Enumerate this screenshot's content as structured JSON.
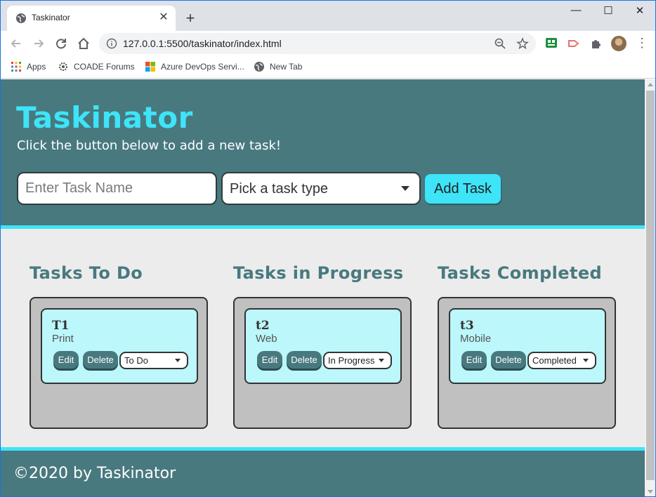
{
  "browser": {
    "tab_title": "Taskinator",
    "new_tab_symbol": "+",
    "close_symbol": "✕",
    "url": "127.0.0.1:5500/taskinator/index.html",
    "bookmarks": [
      "Apps",
      "COADE Forums",
      "Azure DevOps Servi...",
      "New Tab"
    ],
    "window_controls": {
      "minimize": "—",
      "maximize": "☐",
      "close": "✕"
    },
    "menu_symbol": "⋮"
  },
  "header": {
    "title": "Taskinator",
    "subtitle": "Click the button below to add a new task!",
    "task_name_placeholder": "Enter Task Name",
    "task_type_placeholder": "Pick a task type",
    "add_button_label": "Add Task"
  },
  "columns": [
    {
      "title": "Tasks To Do",
      "tasks": [
        {
          "name": "T1",
          "type": "Print",
          "status": "To Do"
        }
      ]
    },
    {
      "title": "Tasks in Progress",
      "tasks": [
        {
          "name": "t2",
          "type": "Web",
          "status": "In Progress"
        }
      ]
    },
    {
      "title": "Tasks Completed",
      "tasks": [
        {
          "name": "t3",
          "type": "Mobile",
          "status": "Completed"
        }
      ]
    }
  ],
  "task_actions": {
    "edit_label": "Edit",
    "delete_label": "Delete"
  },
  "footer": {
    "text": "©2020 by Taskinator"
  },
  "colors": {
    "primary": "#48797f",
    "accent": "#3ee4f8",
    "card": "#bbf7fb",
    "column": "#c0c0c0",
    "page_bg": "#ececec"
  }
}
